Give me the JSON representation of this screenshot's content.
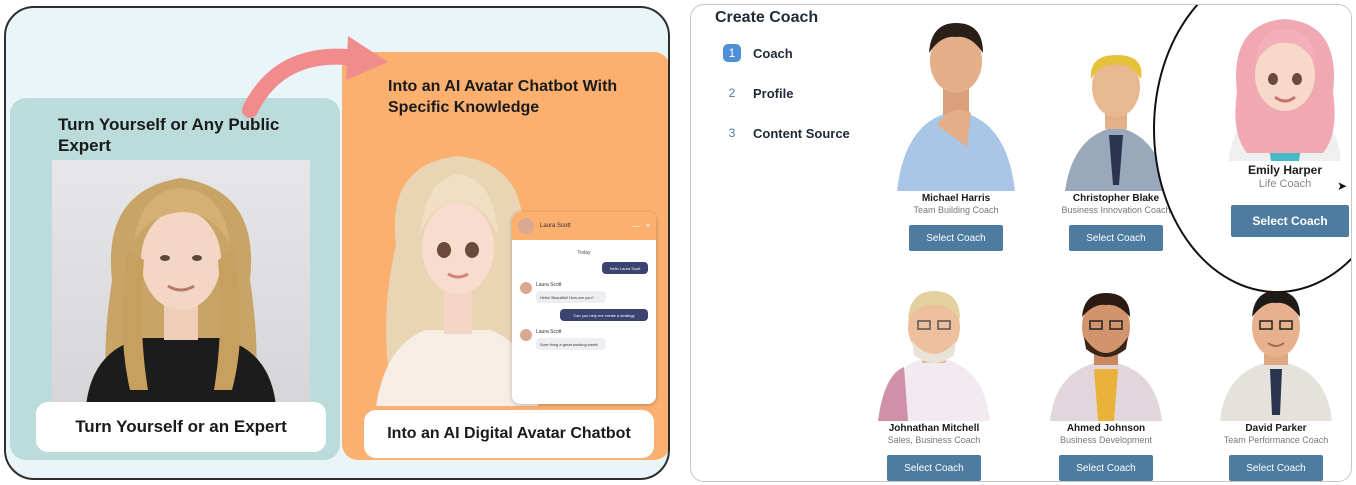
{
  "left": {
    "expert_card": {
      "title": "Turn Yourself or Any Public Expert",
      "caption": "Turn Yourself or an Expert"
    },
    "avatar_card": {
      "title": "Into an AI Avatar Chatbot With Specific Knowledge",
      "caption": "Into an AI Digital Avatar Chatbot",
      "chat": {
        "name": "Laura Scott",
        "minimize": "—",
        "close": "×",
        "day": "Today",
        "msg_out_1": "Hello Laura Scott",
        "msg_in_1_name": "Laura Scott",
        "msg_in_1": "Hello! Beautiful! How are you?",
        "msg_out_2": "Can you help me create a strategy",
        "msg_in_2_name": "Laura Scott",
        "msg_in_2": "Sure thing a great working week!"
      }
    }
  },
  "right": {
    "title": "Create Coach",
    "steps": [
      {
        "num": "1",
        "label": "Coach"
      },
      {
        "num": "2",
        "label": "Profile"
      },
      {
        "num": "3",
        "label": "Content Source"
      }
    ],
    "coaches": [
      {
        "name": "Michael Harris",
        "role": "Team Building Coach",
        "button": "Select Coach"
      },
      {
        "name": "Christopher Blake",
        "role": "Business Innovation Coach",
        "button": "Select Coach"
      },
      {
        "name": "Emily Harper",
        "role": "Life Coach",
        "button": "Select Coach"
      },
      {
        "name": "Johnathan Mitchell",
        "role": "Sales, Business Coach",
        "button": "Select Coach"
      },
      {
        "name": "Ahmed Johnson",
        "role": "Business Development",
        "button": "Select Coach"
      },
      {
        "name": "David Parker",
        "role": "Team Performance Coach",
        "button": "Select Coach"
      }
    ]
  },
  "colors": {
    "teal_card": "#bcdcdc",
    "orange_card": "#fbb06f",
    "button": "#4e7ba0",
    "step_active": "#4f8fd6"
  }
}
